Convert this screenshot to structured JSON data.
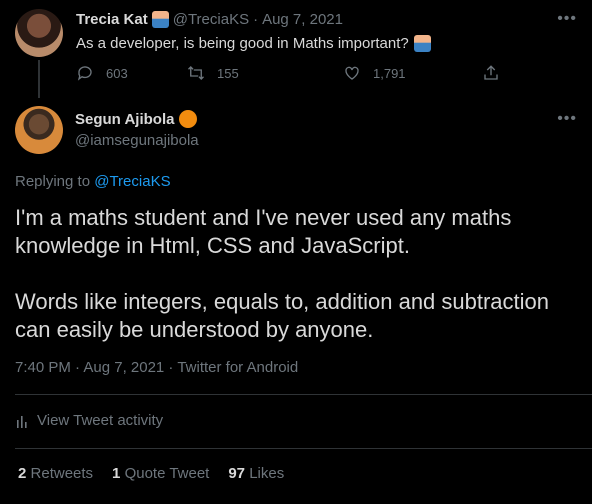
{
  "parent_tweet": {
    "author_name": "Trecia Kat",
    "handle": "@TreciaKS",
    "separator": "·",
    "date": "Aug 7, 2021",
    "text": "As a developer, is being good in Maths important?",
    "reply_count": "603",
    "retweet_count": "155",
    "like_count": "1,791"
  },
  "main_tweet": {
    "author_name": "Segun Ajibola",
    "handle": "@iamsegunajibola",
    "replying_prefix": "Replying to",
    "replying_to": "@TreciaKS",
    "paragraph_1": "I'm a maths student and I've never used any maths knowledge in Html, CSS and JavaScript.",
    "paragraph_2": "Words like integers, equals to, addition and subtraction can easily be understood by anyone.",
    "timestamp": "7:40 PM · Aug 7, 2021 · Twitter for Android",
    "activity_label": "View Tweet activity",
    "stats": {
      "retweets_count": "2",
      "retweets_label": "Retweets",
      "quotes_count": "1",
      "quotes_label": "Quote Tweet",
      "likes_count": "97",
      "likes_label": "Likes"
    }
  },
  "icons": {
    "more": "more-icon",
    "reply": "reply-icon",
    "retweet": "retweet-icon",
    "like": "heart-icon",
    "share": "share-icon",
    "activity": "bar-chart-icon"
  },
  "colors": {
    "background": "#000000",
    "text": "#d9d9d9",
    "muted": "#6e767d",
    "link": "#1d9bf0",
    "badge": "#f28c0f",
    "divider": "#2f3336"
  }
}
